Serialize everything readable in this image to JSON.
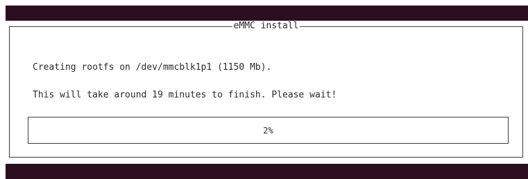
{
  "dialog": {
    "title": "eMMC install",
    "lines": [
      "Creating rootfs on /dev/mmcblk1p1 (1150 Mb).",
      "This will take around 19 minutes to finish. Please wait!"
    ]
  },
  "progress": {
    "label": "2%",
    "percent": 2
  },
  "colors": {
    "terminal_background": "#2c0e1f",
    "dialog_background": "#ffffff",
    "text": "#2a2a2a",
    "border": "#3a3a3a"
  }
}
